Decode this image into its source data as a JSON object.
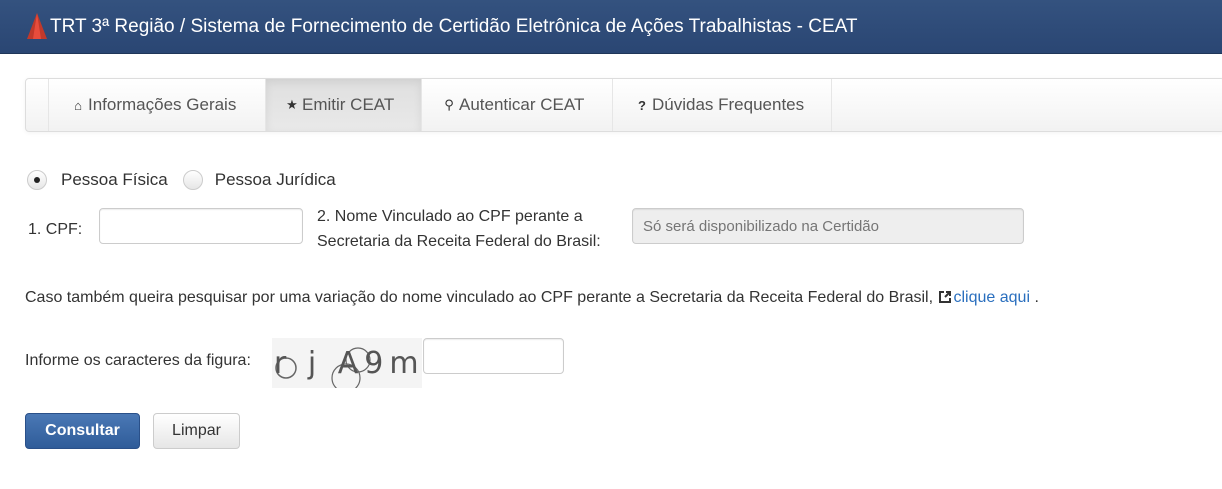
{
  "header": {
    "title": "TRT 3ª Região / Sistema de Fornecimento de Certidão Eletrônica de Ações Trabalhistas - CEAT"
  },
  "nav": [
    {
      "label": "Informações Gerais",
      "icon": "home-icon",
      "glyph": "⌂"
    },
    {
      "label": "Emitir CEAT",
      "icon": "star-icon",
      "glyph": "★"
    },
    {
      "label": "Autenticar CEAT",
      "icon": "search-icon",
      "glyph": "⚲"
    },
    {
      "label": "Dúvidas Frequentes",
      "icon": "question-icon",
      "glyph": "?"
    }
  ],
  "form": {
    "person_type": {
      "fisica_label": "Pessoa Física",
      "juridica_label": "Pessoa Jurídica",
      "selected": "Pessoa Física"
    },
    "cpf_label": "1. CPF:",
    "cpf_value": "",
    "name_label_line1": "2. Nome Vinculado ao CPF perante a",
    "name_label_line2": "Secretaria da Receita Federal do Brasil:",
    "name_placeholder": "Só será disponibilizado na Certidão",
    "info_text": "Caso também queira pesquisar por uma variação do nome vinculado ao CPF perante a Secretaria da Receita Federal do Brasil,",
    "info_link": "clique aqui",
    "info_period": ".",
    "captcha_label": "Informe os caracteres da figura:",
    "captcha_text": "r j A9m",
    "captcha_value": ""
  },
  "buttons": {
    "submit": "Consultar",
    "clear": "Limpar"
  },
  "colors": {
    "header": "#2f4d7b",
    "primary": "#3a67a6",
    "link": "#2a6fbe"
  }
}
